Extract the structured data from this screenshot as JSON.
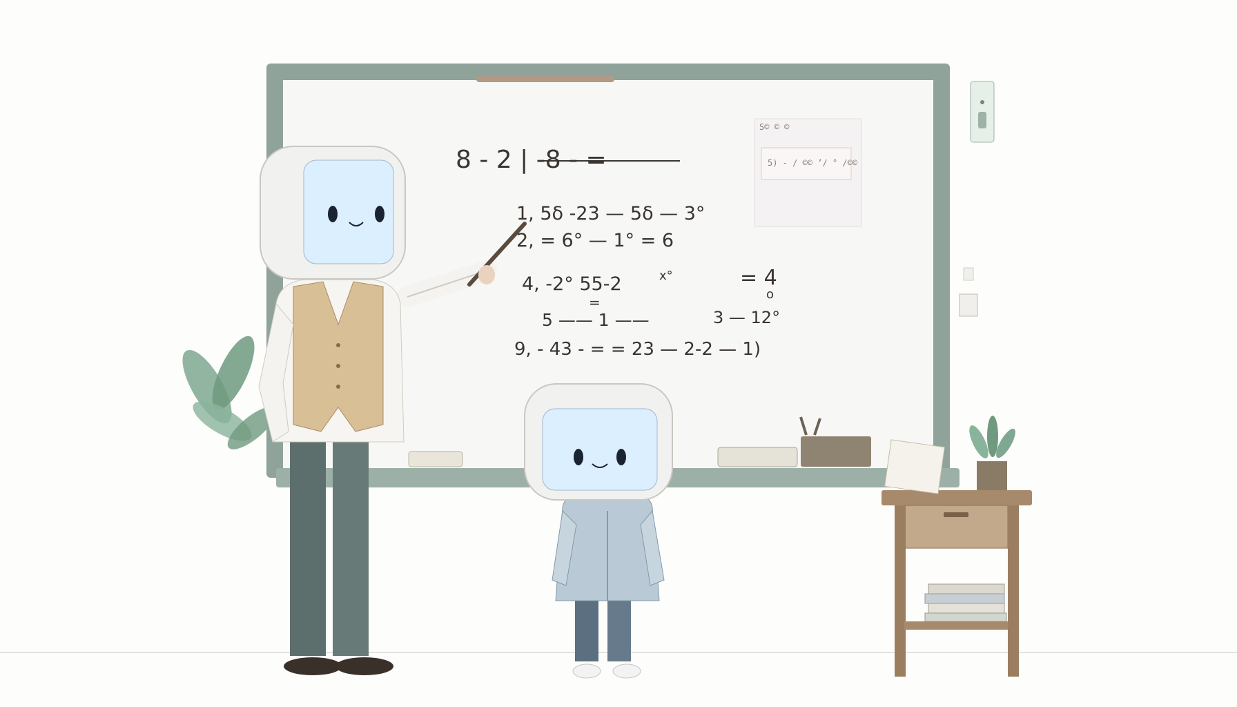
{
  "colors": {
    "background": "#fdfdfb",
    "board_frame": "#8fa39a",
    "board_surface": "#f7f8f6",
    "screen_glow": "#dcefff",
    "vest": "#d8bf95",
    "trousers": "#5d6f6c",
    "jacket": "#b9cad6",
    "desk_wood": "#a7896b",
    "plant": "#6f9a7f",
    "ink": "#3a3430"
  },
  "icons": [
    "teacher-robot",
    "student-robot",
    "pointer-stick",
    "potted-plant",
    "side-table",
    "book-stack",
    "eraser",
    "pencil-holder",
    "note-stand",
    "wall-switch"
  ],
  "whiteboard": {
    "lines": [
      "8 - 2 | -8 -  =",
      "1, 5δ -23 — 5δ — 3°",
      "2, = 6° — 1° = 6",
      "4, -2° 55-2",
      "x°",
      "= 4",
      "o",
      "5 —— 1 ——",
      "=",
      "3 — 12°",
      "9, - 43 - = = 23 — 2-2 — 1)"
    ],
    "note_card": {
      "header": "S© © ©",
      "body": "5) - / ©© ’/ ° /©©"
    }
  }
}
